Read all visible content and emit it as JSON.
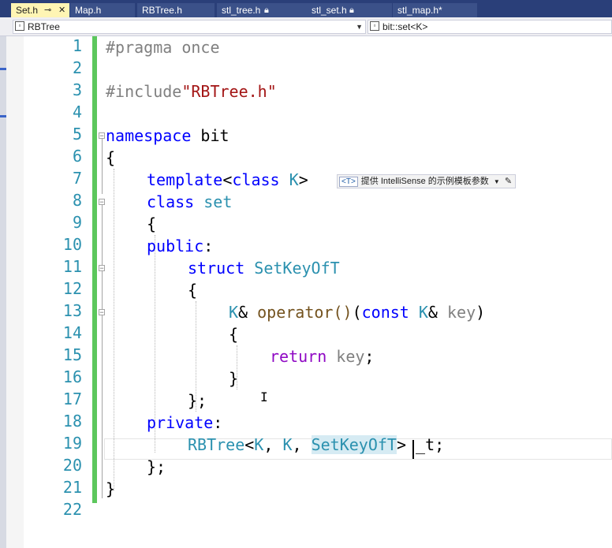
{
  "tabs": [
    {
      "label": "Set.h",
      "active": true,
      "pinned": true,
      "closable": true
    },
    {
      "label": "Map.h"
    },
    {
      "label": "RBTree.h"
    },
    {
      "label": "stl_tree.h",
      "locked": true
    },
    {
      "label": "stl_set.h",
      "locked": true
    },
    {
      "label": "stl_map.h*"
    }
  ],
  "navbar": {
    "scope": "RBTree",
    "member": "bit::set<K>"
  },
  "hint": {
    "tag": "<T>",
    "text": "提供 IntelliSense 的示例模板参数",
    "dropdown_icon": "chevron-down-icon",
    "edit_icon": "pencil-icon"
  },
  "line_numbers": [
    "1",
    "2",
    "3",
    "4",
    "5",
    "6",
    "7",
    "8",
    "9",
    "10",
    "11",
    "12",
    "13",
    "14",
    "15",
    "16",
    "17",
    "18",
    "19",
    "20",
    "21",
    "22"
  ],
  "code": {
    "l1_directive": "#pragma once",
    "l3_directive": "#include",
    "l3_string": "\"RBTree.h\"",
    "l5_kw": "namespace",
    "l5_name": " bit",
    "l6": "{",
    "l7_kw": "template",
    "l7_a": "<",
    "l7_kw2": "class",
    "l7_param": " K",
    "l7_b": ">",
    "l8_kw": "class",
    "l8_name": " set",
    "l9": "{",
    "l10_kw": "public",
    "l10_b": ":",
    "l11_kw": "struct",
    "l11_name": " SetKeyOfT",
    "l12": "{",
    "l13_t": "K",
    "l13_a": "& ",
    "l13_op": "operator()",
    "l13_b": "(",
    "l13_kw": "const",
    "l13_t2": " K",
    "l13_c": "& ",
    "l13_param": "key",
    "l13_d": ")",
    "l14": "{",
    "l15_kw": "return",
    "l15_param": " key",
    "l15_b": ";",
    "l16": "}",
    "l17": "};",
    "l18_kw": "private",
    "l18_b": ":",
    "l19_t": "RBTree",
    "l19_a": "<",
    "l19_t2": "K",
    "l19_b": ", ",
    "l19_t3": "K",
    "l19_c": ", ",
    "l19_t4": "SetKeyOfT",
    "l19_d": "> _t;",
    "l20": "};",
    "l21": "}"
  },
  "colors": {
    "keyword": "#0000ff",
    "type": "#2b91af",
    "string": "#a31515",
    "preprocessor": "#808080",
    "line_number": "#2b91af",
    "change_bar": "#5cc75c",
    "tab_bar": "#2a3f79",
    "active_tab": "#fff5b4"
  }
}
